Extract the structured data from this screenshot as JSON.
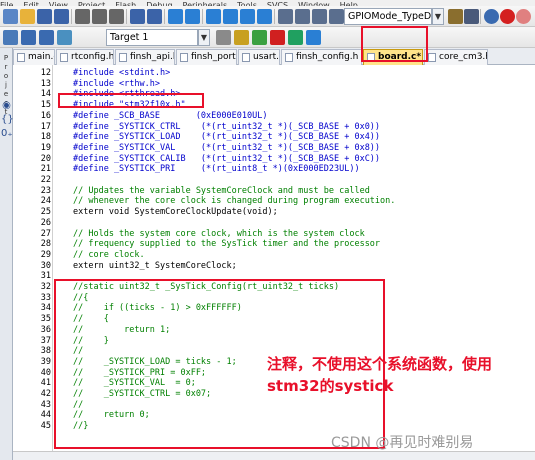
{
  "menubar": {
    "items": [
      "File",
      "Edit",
      "View",
      "Project",
      "Flash",
      "Debug",
      "Peripherals",
      "Tools",
      "SVCS",
      "Window",
      "Help"
    ]
  },
  "toolbar1": {
    "combo_value": "GPIOMode_TypeDef",
    "icons": [
      "new-file-icon",
      "open-folder-icon",
      "save-icon",
      "save-all-icon",
      "cut-icon",
      "copy-icon",
      "paste-icon",
      "undo-icon",
      "redo-icon",
      "navigate-back-icon",
      "navigate-forward-icon",
      "bookmark-icon",
      "prev-bookmark-icon",
      "next-bookmark-icon",
      "clear-bookmarks-icon",
      "indent-icon",
      "unindent-icon",
      "comment-icon",
      "uncomment-icon",
      "find-in-files-icon",
      "find-icon",
      "debug-session-icon",
      "breakpoint-icon",
      "disable-breakpoint-icon",
      "kill-breakpoints-icon"
    ]
  },
  "toolbar2": {
    "target_value": "Target 1",
    "icons": [
      "translate-icon",
      "build-icon",
      "rebuild-icon",
      "download-icon",
      "target-options-icon",
      "manage-components-icon",
      "pack-installer-icon",
      "books-icon",
      "select-packs-icon",
      "event-recorder-icon"
    ]
  },
  "tabs": [
    {
      "label": "main.c",
      "active": false
    },
    {
      "label": "rtconfig.h",
      "active": false
    },
    {
      "label": "finsh_api.h",
      "active": false
    },
    {
      "label": "finsh_port.c",
      "active": false
    },
    {
      "label": "usart.c",
      "active": false
    },
    {
      "label": "finsh_config.h",
      "active": false
    },
    {
      "label": "board.c*",
      "active": true
    },
    {
      "label": "core_cm3.h",
      "active": false
    }
  ],
  "left_panel": {
    "label": "Project"
  },
  "code_lines": [
    {
      "n": "12",
      "text": "#include <stdint.h>",
      "kind": "pp"
    },
    {
      "n": "13",
      "text": "#include <rthw.h>",
      "kind": "pp"
    },
    {
      "n": "14",
      "text": "#include <rtthread.h>",
      "kind": "pp"
    },
    {
      "n": "15",
      "text": "#include \"stm32f10x.h\"",
      "kind": "pp"
    },
    {
      "n": "16",
      "text": "#define _SCB_BASE       (0xE000E010UL)",
      "kind": "pp"
    },
    {
      "n": "17",
      "text": "#define _SYSTICK_CTRL    (*(rt_uint32_t *)(_SCB_BASE + 0x0))",
      "kind": "pp"
    },
    {
      "n": "18",
      "text": "#define _SYSTICK_LOAD    (*(rt_uint32_t *)(_SCB_BASE + 0x4))",
      "kind": "pp"
    },
    {
      "n": "19",
      "text": "#define _SYSTICK_VAL     (*(rt_uint32_t *)(_SCB_BASE + 0x8))",
      "kind": "pp"
    },
    {
      "n": "20",
      "text": "#define _SYSTICK_CALIB   (*(rt_uint32_t *)(_SCB_BASE + 0xC))",
      "kind": "pp"
    },
    {
      "n": "21",
      "text": "#define _SYSTICK_PRI     (*(rt_uint8_t *)(0xE000ED23UL))",
      "kind": "pp"
    },
    {
      "n": "22",
      "text": "",
      "kind": "plain"
    },
    {
      "n": "23",
      "text": "// Updates the variable SystemCoreClock and must be called",
      "kind": "cm"
    },
    {
      "n": "24",
      "text": "// whenever the core clock is changed during program execution.",
      "kind": "cm"
    },
    {
      "n": "25",
      "text": "extern void SystemCoreClockUpdate(void);",
      "kind": "plain"
    },
    {
      "n": "26",
      "text": "",
      "kind": "plain"
    },
    {
      "n": "27",
      "text": "// Holds the system core clock, which is the system clock",
      "kind": "cm"
    },
    {
      "n": "28",
      "text": "// frequency supplied to the SysTick timer and the processor",
      "kind": "cm"
    },
    {
      "n": "29",
      "text": "// core clock.",
      "kind": "cm"
    },
    {
      "n": "30",
      "text": "extern uint32_t SystemCoreClock;",
      "kind": "plain"
    },
    {
      "n": "31",
      "text": "",
      "kind": "plain"
    },
    {
      "n": "32",
      "text": "//static uint32_t _SysTick_Config(rt_uint32_t ticks)",
      "kind": "cm"
    },
    {
      "n": "33",
      "text": "//{",
      "kind": "cm"
    },
    {
      "n": "34",
      "text": "//    if ((ticks - 1) > 0xFFFFFF)",
      "kind": "cm"
    },
    {
      "n": "35",
      "text": "//    {",
      "kind": "cm"
    },
    {
      "n": "36",
      "text": "//        return 1;",
      "kind": "cm"
    },
    {
      "n": "37",
      "text": "//    }",
      "kind": "cm"
    },
    {
      "n": "38",
      "text": "//",
      "kind": "cm"
    },
    {
      "n": "39",
      "text": "//    _SYSTICK_LOAD = ticks - 1;",
      "kind": "cm"
    },
    {
      "n": "40",
      "text": "//    _SYSTICK_PRI = 0xFF;",
      "kind": "cm"
    },
    {
      "n": "41",
      "text": "//    _SYSTICK_VAL  = 0;",
      "kind": "cm"
    },
    {
      "n": "42",
      "text": "//    _SYSTICK_CTRL = 0x07;",
      "kind": "cm"
    },
    {
      "n": "43",
      "text": "//",
      "kind": "cm"
    },
    {
      "n": "44",
      "text": "//    return 0;",
      "kind": "cm"
    },
    {
      "n": "45",
      "text": "//}",
      "kind": "cm"
    }
  ],
  "annotation": {
    "line1": "注释，不使用这个系统函数，使用",
    "line2": "stm32的systick"
  },
  "watermark": "CSDN @再见时难别易",
  "colors": {
    "highlight_red": "#e8102a",
    "comment_green": "#008000",
    "preprocessor_blue": "#0000cc",
    "active_tab": "#ffe48a"
  }
}
